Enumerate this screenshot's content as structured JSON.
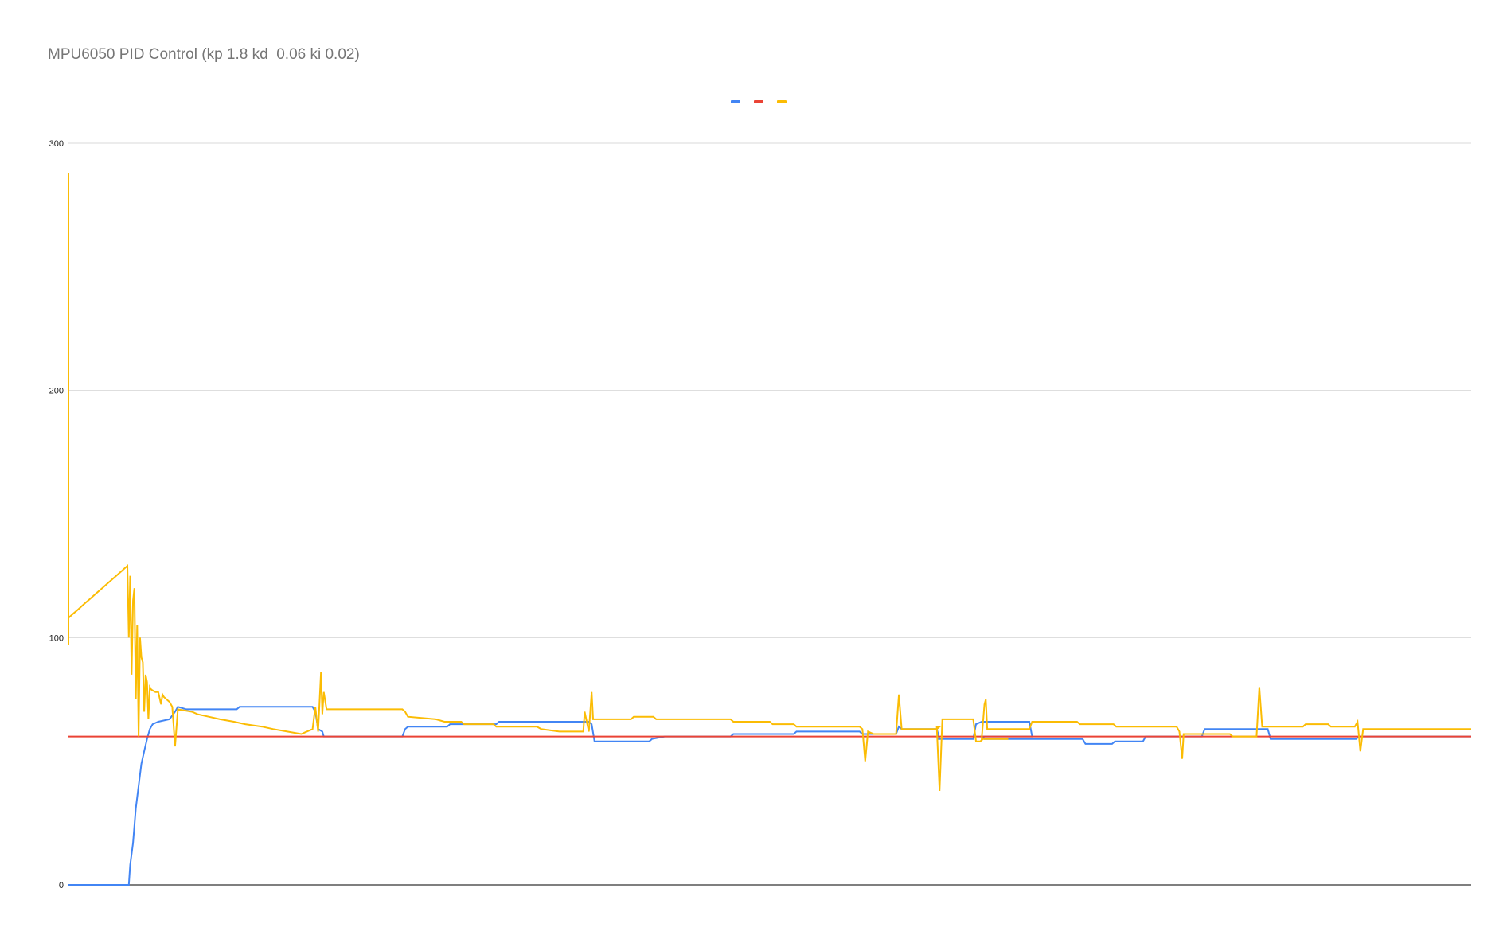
{
  "chart_data": {
    "type": "line",
    "title": "MPU6050 PID Control (kp 1.8 kd  0.06 ki 0.02)",
    "xlabel": "",
    "ylabel": "",
    "ylim": [
      0,
      300
    ],
    "yticks": [
      0,
      100,
      200,
      300
    ],
    "grid": true,
    "legend": "top-center",
    "xlim": [
      0,
      1000
    ],
    "series": [
      {
        "color": "#4285F4",
        "points": [
          [
            0,
            0
          ],
          [
            43,
            0
          ],
          [
            44,
            8
          ],
          [
            46,
            17
          ],
          [
            48,
            31
          ],
          [
            50,
            40
          ],
          [
            52,
            49
          ],
          [
            54,
            54
          ],
          [
            56,
            59
          ],
          [
            58,
            63
          ],
          [
            60,
            65
          ],
          [
            64,
            66
          ],
          [
            72,
            67
          ],
          [
            76,
            70
          ],
          [
            78,
            72
          ],
          [
            84,
            71
          ],
          [
            120,
            71
          ],
          [
            122,
            72
          ],
          [
            174,
            72
          ],
          [
            176,
            70
          ],
          [
            178,
            63
          ],
          [
            181,
            62
          ],
          [
            182,
            60
          ],
          [
            238,
            60
          ],
          [
            240,
            63
          ],
          [
            242,
            64
          ],
          [
            270,
            64
          ],
          [
            272,
            65
          ],
          [
            305,
            65
          ],
          [
            307,
            66
          ],
          [
            371,
            66
          ],
          [
            373,
            65
          ],
          [
            375,
            58
          ],
          [
            414,
            58
          ],
          [
            416,
            59
          ],
          [
            425,
            60
          ],
          [
            472,
            60
          ],
          [
            474,
            61
          ],
          [
            517,
            61
          ],
          [
            519,
            62
          ],
          [
            564,
            62
          ],
          [
            566,
            61
          ],
          [
            590,
            61
          ],
          [
            592,
            64
          ],
          [
            594,
            63
          ],
          [
            619,
            63
          ],
          [
            621,
            59
          ],
          [
            619,
            59
          ],
          [
            621,
            59
          ],
          [
            645,
            59
          ],
          [
            647,
            65
          ],
          [
            651,
            66
          ],
          [
            685,
            66
          ],
          [
            687,
            60
          ],
          [
            650,
            60
          ],
          [
            652,
            60
          ],
          [
            653,
            59
          ],
          [
            723,
            59
          ],
          [
            725,
            57
          ],
          [
            744,
            57
          ],
          [
            746,
            58
          ],
          [
            766,
            58
          ],
          [
            768,
            60
          ],
          [
            808,
            60
          ],
          [
            810,
            63
          ],
          [
            855,
            63
          ],
          [
            857,
            59
          ],
          [
            918,
            59
          ],
          [
            920,
            60
          ],
          [
            1000,
            60
          ]
        ]
      },
      {
        "color": "#EA4335",
        "points": [
          [
            0,
            60
          ],
          [
            1000,
            60
          ]
        ]
      },
      {
        "color": "#FBBC04",
        "points": [
          [
            0,
            97
          ],
          [
            0,
            288
          ],
          [
            0,
            108
          ],
          [
            2,
            109
          ],
          [
            4,
            110
          ],
          [
            6,
            111
          ],
          [
            8,
            112
          ],
          [
            10,
            113
          ],
          [
            12,
            114
          ],
          [
            14,
            115
          ],
          [
            16,
            116
          ],
          [
            18,
            117
          ],
          [
            20,
            118
          ],
          [
            22,
            119
          ],
          [
            24,
            120
          ],
          [
            26,
            121
          ],
          [
            28,
            122
          ],
          [
            30,
            123
          ],
          [
            32,
            124
          ],
          [
            34,
            125
          ],
          [
            36,
            126
          ],
          [
            38,
            127
          ],
          [
            40,
            128
          ],
          [
            42,
            129
          ],
          [
            43,
            100
          ],
          [
            44,
            125
          ],
          [
            45,
            85
          ],
          [
            46,
            115
          ],
          [
            47,
            120
          ],
          [
            48,
            75
          ],
          [
            49,
            105
          ],
          [
            50,
            60
          ],
          [
            51,
            100
          ],
          [
            52,
            92
          ],
          [
            53,
            90
          ],
          [
            54,
            70
          ],
          [
            55,
            85
          ],
          [
            56,
            82
          ],
          [
            57,
            67
          ],
          [
            58,
            80
          ],
          [
            59,
            79
          ],
          [
            62,
            78
          ],
          [
            64,
            78
          ],
          [
            66,
            73
          ],
          [
            67,
            77
          ],
          [
            68,
            76
          ],
          [
            70,
            75
          ],
          [
            72,
            74
          ],
          [
            74,
            72
          ],
          [
            76,
            56
          ],
          [
            78,
            71
          ],
          [
            88,
            70
          ],
          [
            92,
            69
          ],
          [
            100,
            68
          ],
          [
            108,
            67
          ],
          [
            118,
            66
          ],
          [
            126,
            65
          ],
          [
            138,
            64
          ],
          [
            146,
            63
          ],
          [
            156,
            62
          ],
          [
            166,
            61
          ],
          [
            174,
            63
          ],
          [
            176,
            72
          ],
          [
            178,
            62
          ],
          [
            180,
            86
          ],
          [
            181,
            69
          ],
          [
            182,
            78
          ],
          [
            184,
            71
          ],
          [
            238,
            71
          ],
          [
            240,
            70
          ],
          [
            242,
            68
          ],
          [
            262,
            67
          ],
          [
            268,
            66
          ],
          [
            280,
            66
          ],
          [
            282,
            65
          ],
          [
            303,
            65
          ],
          [
            305,
            64
          ],
          [
            334,
            64
          ],
          [
            337,
            63
          ],
          [
            350,
            62
          ],
          [
            367,
            62
          ],
          [
            368,
            70
          ],
          [
            371,
            62
          ],
          [
            373,
            78
          ],
          [
            374,
            67
          ],
          [
            401,
            67
          ],
          [
            403,
            68
          ],
          [
            417,
            68
          ],
          [
            419,
            67
          ],
          [
            472,
            67
          ],
          [
            474,
            66
          ],
          [
            500,
            66
          ],
          [
            502,
            65
          ],
          [
            517,
            65
          ],
          [
            519,
            64
          ],
          [
            564,
            64
          ],
          [
            566,
            63
          ],
          [
            568,
            50
          ],
          [
            570,
            62
          ],
          [
            574,
            61
          ],
          [
            590,
            61
          ],
          [
            592,
            77
          ],
          [
            594,
            63
          ],
          [
            619,
            63
          ],
          [
            621,
            64
          ],
          [
            619,
            64
          ],
          [
            621,
            38
          ],
          [
            623,
            67
          ],
          [
            645,
            67
          ],
          [
            647,
            58
          ],
          [
            650,
            58
          ],
          [
            652,
            59
          ],
          [
            670,
            59
          ],
          [
            651,
            59
          ],
          [
            653,
            73
          ],
          [
            654,
            75
          ],
          [
            655,
            63
          ],
          [
            685,
            63
          ],
          [
            687,
            66
          ],
          [
            719,
            66
          ],
          [
            721,
            65
          ],
          [
            745,
            65
          ],
          [
            747,
            64
          ],
          [
            790,
            64
          ],
          [
            792,
            62
          ],
          [
            794,
            51
          ],
          [
            795,
            61
          ],
          [
            828,
            61
          ],
          [
            830,
            60
          ],
          [
            847,
            60
          ],
          [
            849,
            80
          ],
          [
            851,
            64
          ],
          [
            880,
            64
          ],
          [
            882,
            65
          ],
          [
            898,
            65
          ],
          [
            900,
            64
          ],
          [
            917,
            64
          ],
          [
            919,
            66
          ],
          [
            921,
            54
          ],
          [
            923,
            63
          ],
          [
            1000,
            63
          ]
        ]
      }
    ]
  }
}
